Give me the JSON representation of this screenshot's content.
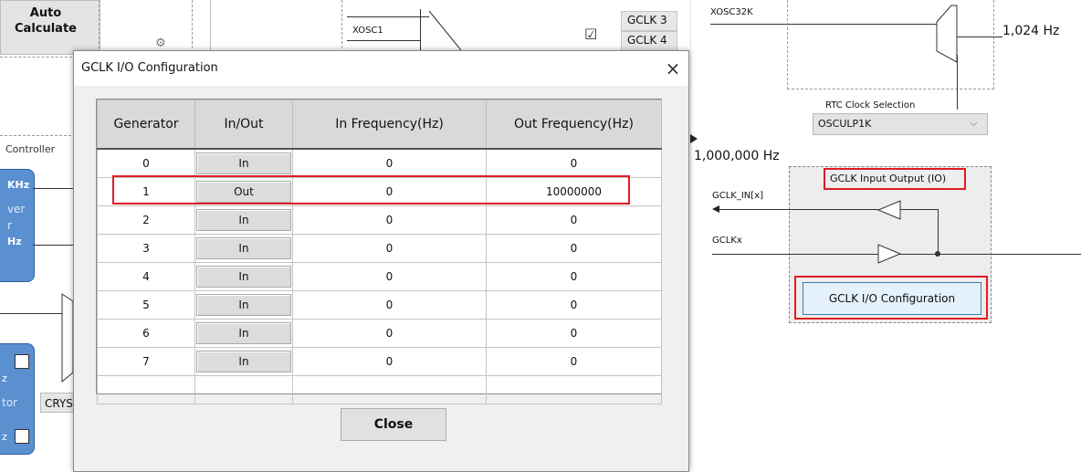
{
  "background": {
    "auto_calculate_label": "Auto\nCalculate",
    "xosc1_label": "XOSC1",
    "gclk_list": [
      "GCLK 3",
      "GCLK 4"
    ],
    "checkbox_symbol": "☑",
    "xosc32k_label": "XOSC32K",
    "freq_1024": "1,024 Hz",
    "rtc_clock_selection_label": "RTC Clock Selection",
    "rtc_clock_selection_value": "OSCULP1K",
    "freq_1000000": "1,000,000 Hz",
    "controller_label": "Controller",
    "gclk_io_panel_title": "GCLK Input Output (IO)",
    "gclk_in_label": "GCLK_IN[x]",
    "gclkx_label": "GCLKx",
    "gclk_io_config_button": "GCLK I/O Configuration",
    "crystal_label": "CRYS",
    "blue_block_texts": [
      "KHz",
      "ver",
      "r",
      "Hz"
    ],
    "blue_block2_texts": [
      "z",
      "tor",
      "z"
    ],
    "accent_red": "#e01b24",
    "accent_blue": "#5a8fd0"
  },
  "dialog": {
    "title": "GCLK I/O Configuration",
    "close_icon": "×",
    "columns": [
      "Generator",
      "In/Out",
      "In Frequency(Hz)",
      "Out Frequency(Hz)"
    ],
    "rows": [
      {
        "generator": "0",
        "inout": "In",
        "in_freq": "0",
        "out_freq": "0"
      },
      {
        "generator": "1",
        "inout": "Out",
        "in_freq": "0",
        "out_freq": "10000000"
      },
      {
        "generator": "2",
        "inout": "In",
        "in_freq": "0",
        "out_freq": "0"
      },
      {
        "generator": "3",
        "inout": "In",
        "in_freq": "0",
        "out_freq": "0"
      },
      {
        "generator": "4",
        "inout": "In",
        "in_freq": "0",
        "out_freq": "0"
      },
      {
        "generator": "5",
        "inout": "In",
        "in_freq": "0",
        "out_freq": "0"
      },
      {
        "generator": "6",
        "inout": "In",
        "in_freq": "0",
        "out_freq": "0"
      },
      {
        "generator": "7",
        "inout": "In",
        "in_freq": "0",
        "out_freq": "0"
      }
    ],
    "close_button": "Close"
  }
}
